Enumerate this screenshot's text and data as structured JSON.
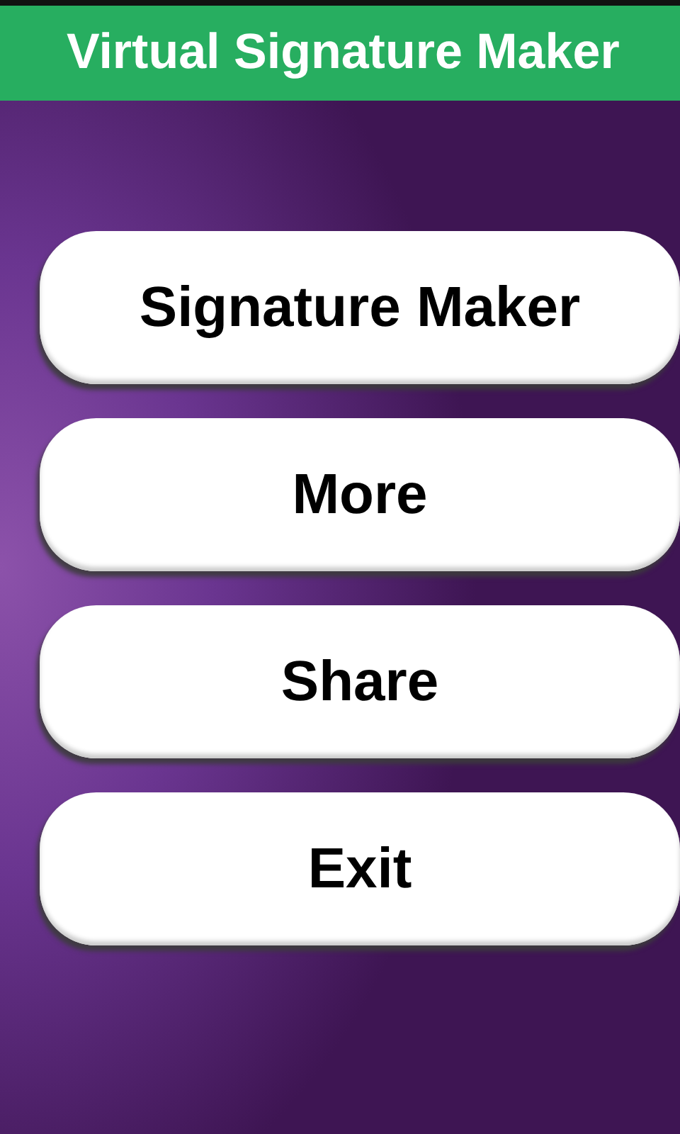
{
  "app_bar": {
    "title": "Virtual Signature Maker"
  },
  "buttons": [
    {
      "label": "Signature Maker"
    },
    {
      "label": "More"
    },
    {
      "label": "Share"
    },
    {
      "label": "Exit"
    }
  ]
}
